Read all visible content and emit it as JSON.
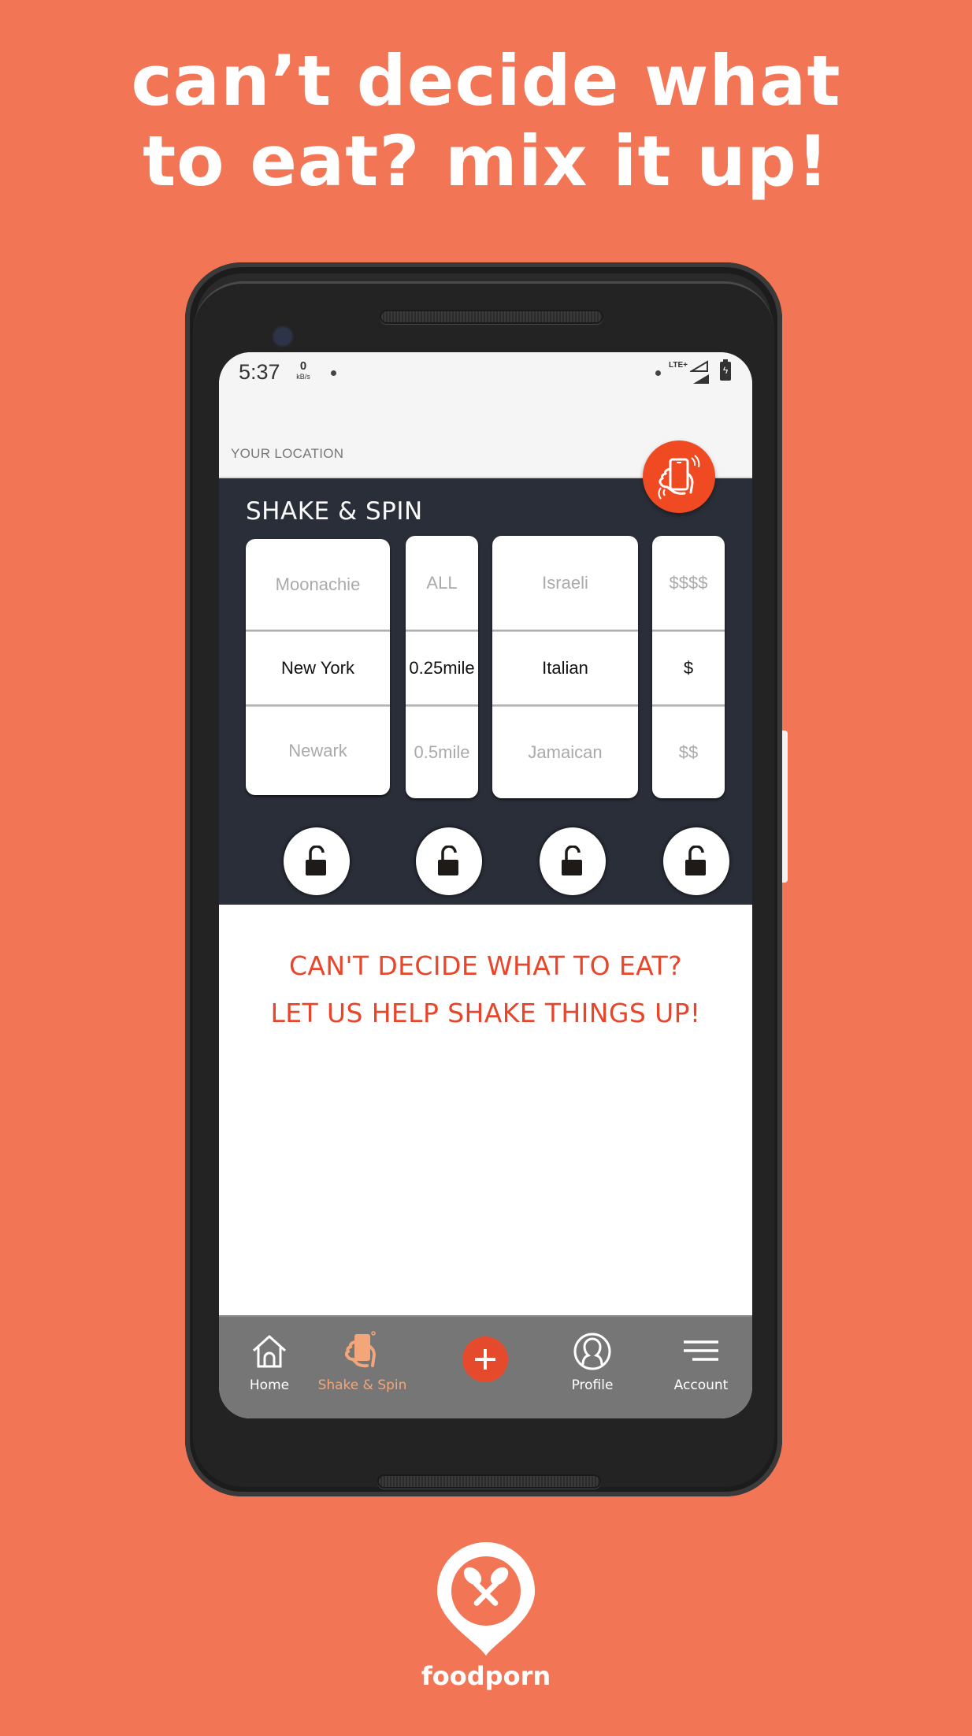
{
  "promo": {
    "headline_line1": "can’t decide what",
    "headline_line2": "to eat? mix it up!",
    "brand_name": "foodporn",
    "background_color": "#f27656"
  },
  "status_bar": {
    "time": "5:37",
    "net_speed_value": "0",
    "net_speed_unit": "kB/s",
    "network_type": "LTE+",
    "icons": [
      "notification-dot",
      "signal-icon",
      "signal-icon",
      "battery-charging-icon"
    ]
  },
  "location": {
    "label": "YOUR LOCATION"
  },
  "shake_spin": {
    "title": "SHAKE & SPIN",
    "fab_icon": "shake-phone-icon",
    "accent_color": "#f04a22",
    "columns": [
      {
        "name": "city",
        "above": "Moonachie",
        "selected": "New York",
        "below": "Newark",
        "locked": false
      },
      {
        "name": "distance",
        "above": "ALL",
        "selected": "0.25mile",
        "below": "0.5mile",
        "locked": false
      },
      {
        "name": "cuisine",
        "above": "Israeli",
        "selected": "Italian",
        "below": "Jamaican",
        "locked": false
      },
      {
        "name": "price",
        "above": "$$$$",
        "selected": "$",
        "below": "$$",
        "locked": false
      }
    ]
  },
  "message": {
    "line1": "CAN'T DECIDE WHAT TO EAT?",
    "line2": "LET US HELP SHAKE THINGS UP!",
    "color": "#e8452a"
  },
  "bottom_nav": {
    "items": [
      {
        "label": "Home",
        "icon": "home-icon",
        "active": false
      },
      {
        "label": "Shake & Spin",
        "icon": "shake-phone-icon",
        "active": true
      },
      {
        "label": "",
        "icon": "plus-icon",
        "active": false
      },
      {
        "label": "Profile",
        "icon": "profile-icon",
        "active": false
      },
      {
        "label": "Account",
        "icon": "menu-icon",
        "active": false
      }
    ],
    "active_color": "#f2a67a"
  }
}
